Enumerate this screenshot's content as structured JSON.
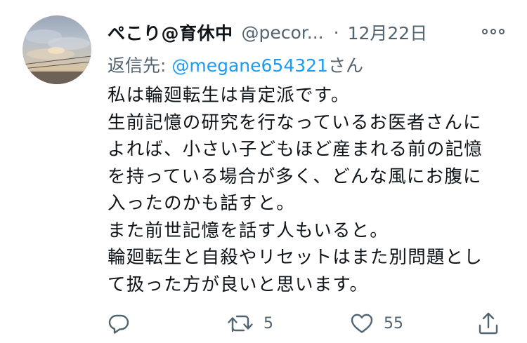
{
  "tweet": {
    "display_name": "ぺこり@育休中",
    "handle": "@pecor...",
    "separator": "·",
    "timestamp": "12月22日",
    "reply_to": {
      "prefix": "返信先: ",
      "mention": "@megane654321",
      "suffix": "さん"
    },
    "lines": [
      "私は輪廻転生は肯定派です。",
      "生前記憶の研究を行なっているお医者さんに",
      "よれば、小さい子どもほど産まれる前の記憶",
      "を持っている場合が多く、どんな風にお腹に",
      "入ったのかも話すと。",
      "また前世記憶を話す人もいると。",
      "輪廻転生と自殺やリセットはまた別問題とし",
      "て扱った方が良いと思います。"
    ],
    "actions": {
      "reply_icon": "reply-icon",
      "retweet_icon": "retweet-icon",
      "retweet_count": "5",
      "like_icon": "heart-icon",
      "like_count": "55",
      "share_icon": "share-icon"
    },
    "more_icon": "more-icon"
  },
  "colors": {
    "text_primary": "#0f1419",
    "text_secondary": "#536471",
    "link": "#1d9bf0"
  }
}
